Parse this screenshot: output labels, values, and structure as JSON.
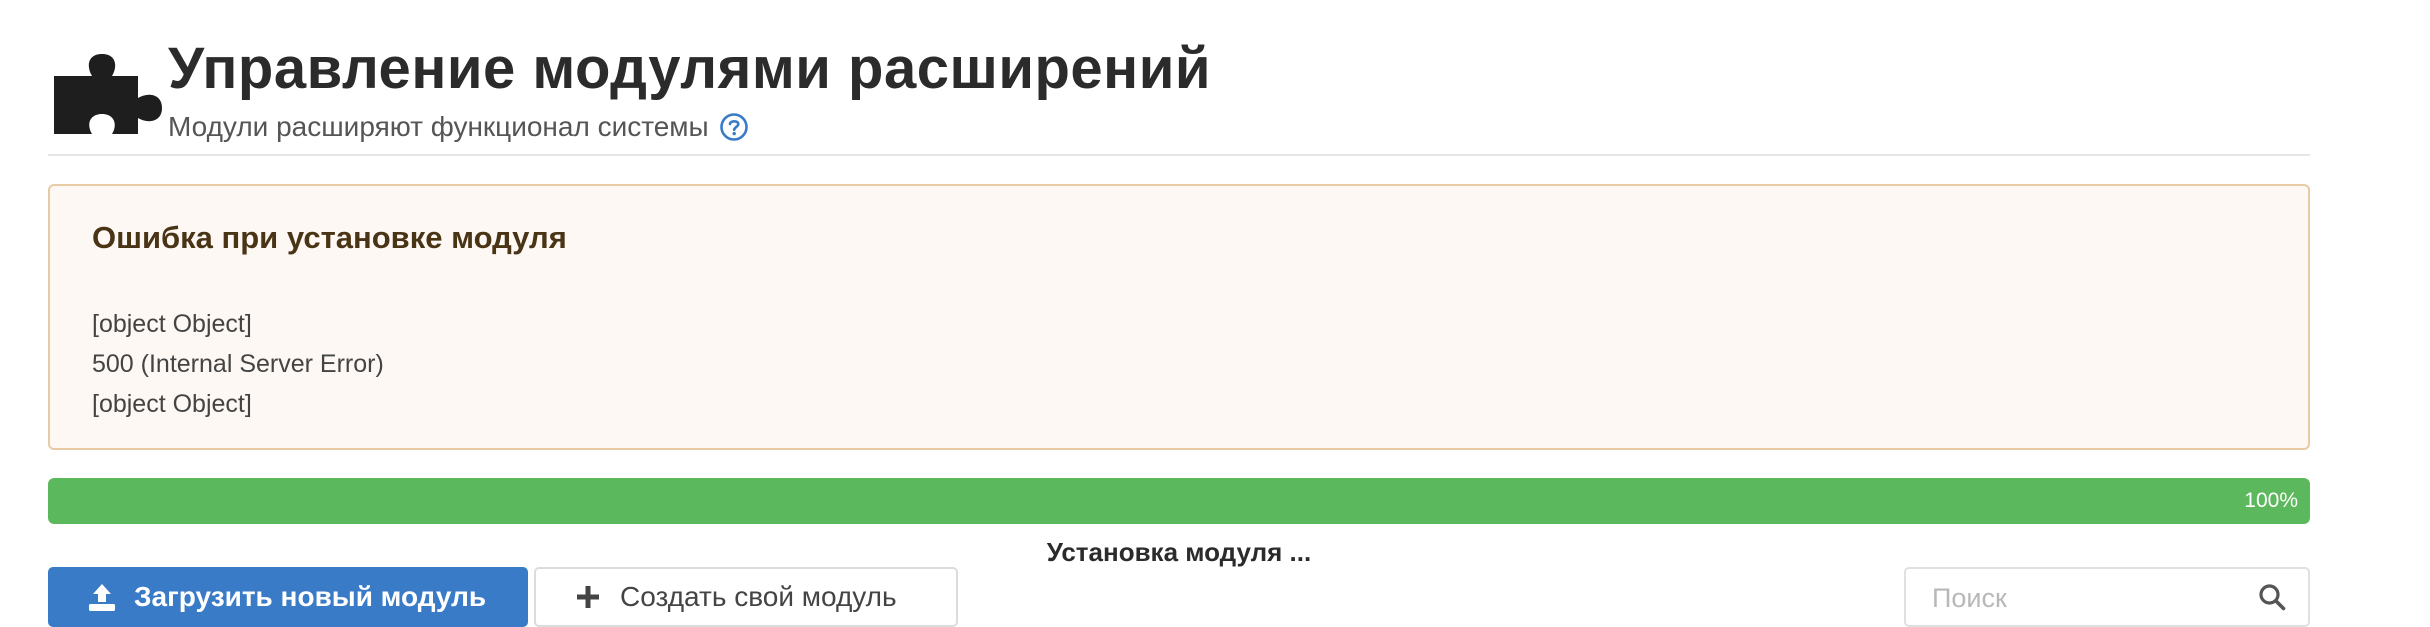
{
  "header": {
    "title": "Управление модулями расширений",
    "subtitle": "Модули расширяют функционал системы"
  },
  "alert": {
    "title": "Ошибка при установке модуля",
    "lines": [
      "[object Object]",
      "500 (Internal Server Error)",
      "[object Object]"
    ]
  },
  "progress": {
    "value": 100,
    "label": "100%",
    "status": "Установка модуля ..."
  },
  "actions": {
    "upload_label": "Загрузить новый модуль",
    "create_label": "Создать свой модуль"
  },
  "search": {
    "placeholder": "Поиск"
  },
  "icons": {
    "header": "puzzle-icon",
    "help": "help-icon",
    "upload": "upload-icon",
    "create": "plus-icon",
    "search": "search-icon"
  },
  "colors": {
    "primary": "#3a7bc8",
    "success": "#5cb85c",
    "alert_bg": "#fdf8f4",
    "alert_border": "#e8cba6",
    "alert_title": "#4a3416"
  }
}
